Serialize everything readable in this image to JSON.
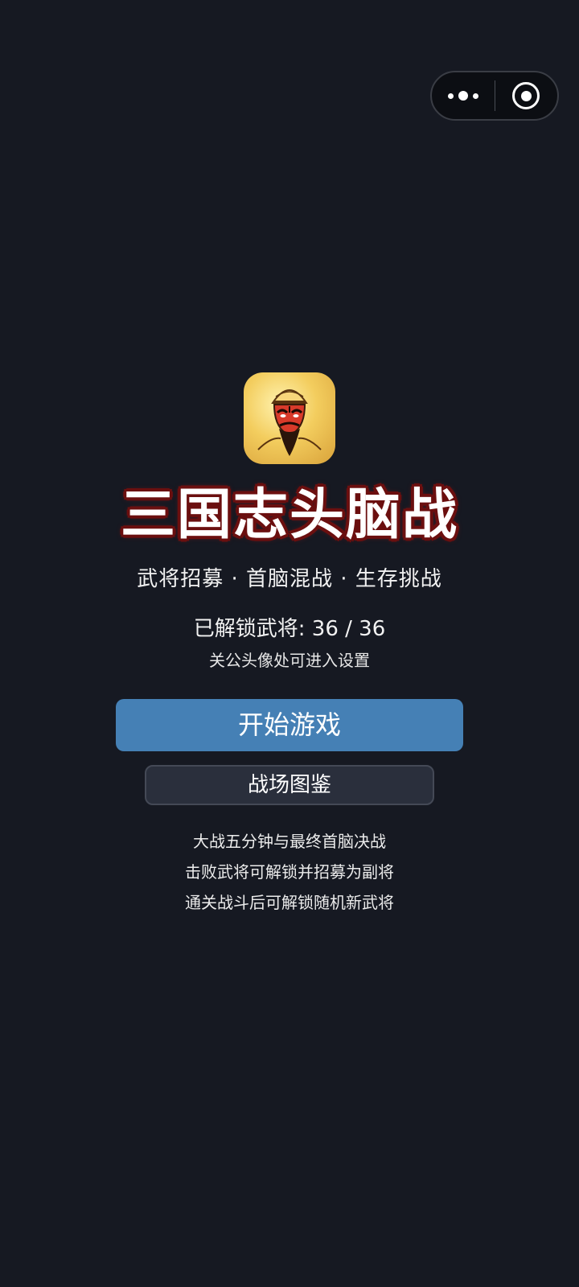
{
  "capsule": {
    "more_icon": "more-dots-icon",
    "close_icon": "target-circle-icon"
  },
  "app": {
    "icon": "general-face-logo",
    "title": "三国志头脑战",
    "subtitle": "武将招募 · 首脑混战 · 生存挑战",
    "unlock_status": "已解锁武将: 36 / 36",
    "settings_hint": "关公头像处可进入设置"
  },
  "buttons": {
    "start_label": "开始游戏",
    "codex_label": "战场图鉴"
  },
  "description": [
    "大战五分钟与最终首脑决战",
    "击败武将可解锁并招募为副将",
    "通关战斗后可解锁随机新武将"
  ],
  "colors": {
    "background": "#161922",
    "start_button": "#4580b5",
    "codex_button": "#2a2f3c",
    "title_outline": "#6b0f0f"
  }
}
